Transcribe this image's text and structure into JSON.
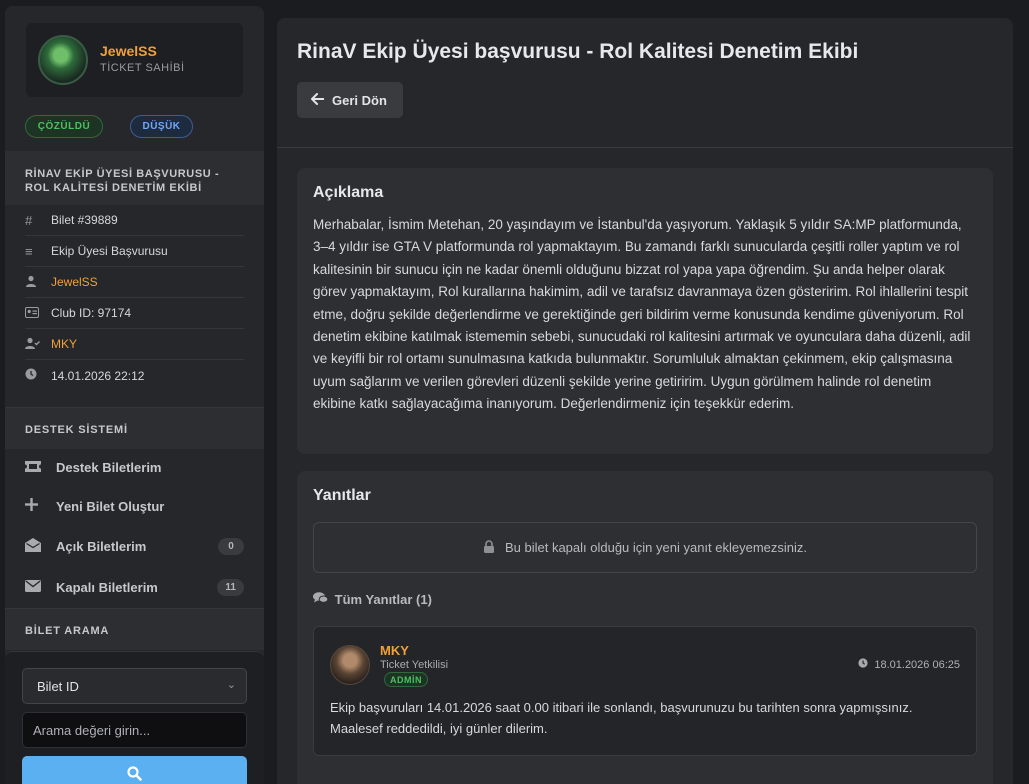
{
  "user": {
    "name": "JewelSS",
    "role": "TİCKET SAHİBİ"
  },
  "badges": {
    "status": "ÇÖZÜLDÜ",
    "priority": "DÜŞÜK"
  },
  "ticket": {
    "sidebar_title": "RİNAV EKİP ÜYESİ BAŞVURUSU - ROL KALİTESİ DENETİM EKİBİ",
    "meta": [
      {
        "icon": "hash-icon",
        "text": "Bilet #39889"
      },
      {
        "icon": "list-icon",
        "text": "Ekip Üyesi Başvurusu"
      },
      {
        "icon": "user-icon",
        "text": "JewelSS"
      },
      {
        "icon": "id-card-icon",
        "text": "Club ID: 97174"
      },
      {
        "icon": "user-check-icon",
        "text": "MKY"
      },
      {
        "icon": "clock-icon",
        "text": "14.01.2026 22:12"
      }
    ]
  },
  "support": {
    "heading": "DESTEK SİSTEMİ",
    "items": [
      {
        "icon": "ticket-icon",
        "label": "Destek Biletlerim",
        "count": ""
      },
      {
        "icon": "plus-icon",
        "label": "Yeni Bilet Oluştur",
        "count": ""
      },
      {
        "icon": "envelope-open-icon",
        "label": "Açık Biletlerim",
        "count": "0"
      },
      {
        "icon": "envelope-icon",
        "label": "Kapalı Biletlerim",
        "count": "11"
      }
    ]
  },
  "search": {
    "heading": "BİLET ARAMA",
    "select_value": "Bilet ID",
    "placeholder": "Arama değeri girin..."
  },
  "main": {
    "title": "RinaV Ekip Üyesi başvurusu - Rol Kalitesi Denetim Ekibi",
    "back_label": "Geri Dön",
    "description_heading": "Açıklama",
    "description": "Merhabalar, İsmim Metehan, 20 yaşındayım ve İstanbul'da yaşıyorum. Yaklaşık 5 yıldır SA:MP platformunda, 3–4 yıldır ise GTA V platformunda rol yapmaktayım. Bu zamandı farklı sunucularda çeşitli roller yaptım ve rol kalitesinin bir sunucu için ne kadar önemli olduğunu bizzat rol yapa yapa öğrendim. Şu anda helper olarak görev yapmaktayım, Rol kurallarına hakimim, adil ve tarafsız davranmaya özen gösteririm. Rol ihlallerini tespit etme, doğru şekilde değerlendirme ve gerektiğinde geri bildirim verme konusunda kendime güveniyorum. Rol denetim ekibine katılmak istememin sebebi, sunucudaki rol kalitesini artırmak ve oyunculara daha düzenli, adil ve keyifli bir rol ortamı sunulmasına katkıda bulunmaktır. Sorumluluk almaktan çekinmem, ekip çalışmasına uyum sağlarım ve verilen görevleri düzenli şekilde yerine getiririm. Uygun görülmem halinde rol denetim ekibine katkı sağlayacağıma inanıyorum. Değerlendirmeniz için teşekkür ederim.",
    "replies_heading": "Yanıtlar",
    "locked_message": "Bu bilet kapalı olduğu için yeni yanıt ekleyemezsiniz.",
    "all_replies_label": "Tüm Yanıtlar (1)",
    "replies": [
      {
        "name": "MKY",
        "role": "Ticket Yetkilisi",
        "badge": "ADMİN",
        "date": "18.01.2026 06:25",
        "text": "Ekip başvuruları 14.01.2026 saat 0.00 itibari ile sonlandı, başvurunuzu bu tarihten sonra yapmışsınız. Maalesef reddedildi, iyi günler dilerim."
      }
    ]
  },
  "colors": {
    "accent_orange": "#f0a038",
    "status_green": "#4cc05d",
    "priority_blue": "#6ea8ff",
    "search_button": "#5ab0f0"
  }
}
